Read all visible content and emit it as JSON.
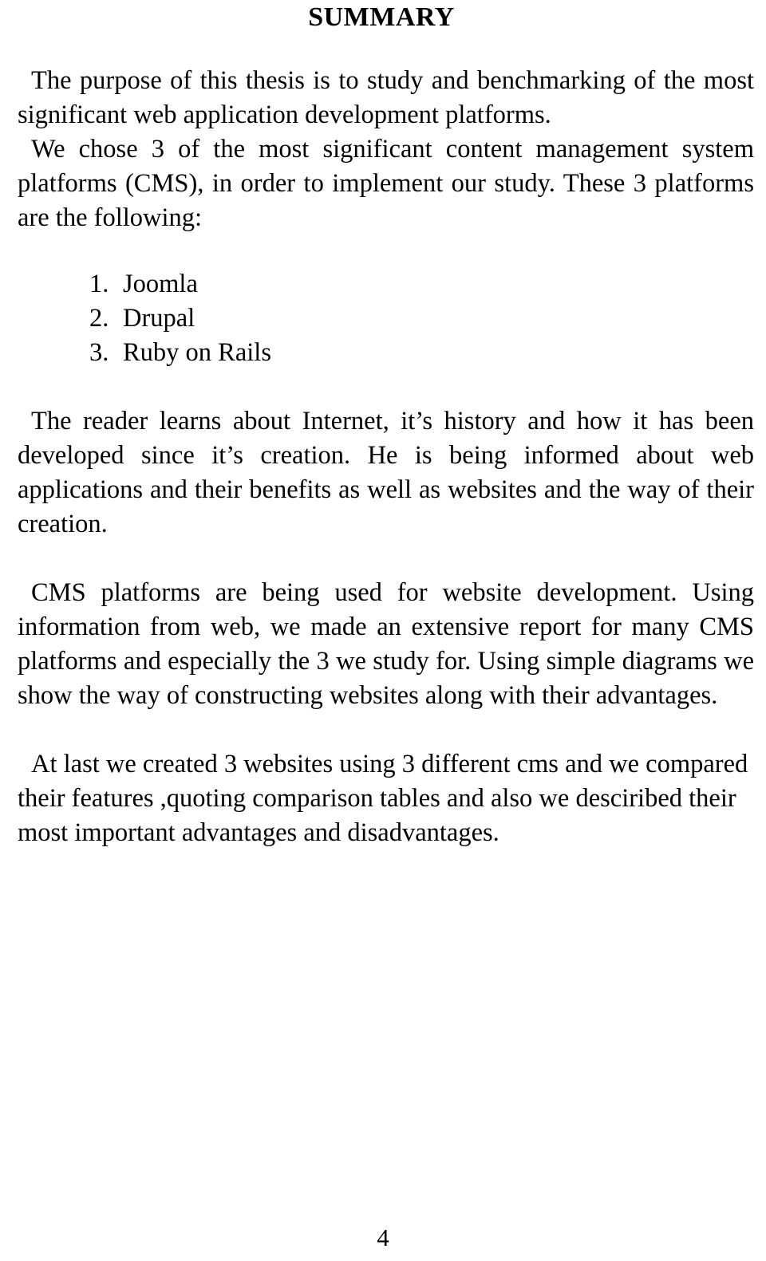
{
  "document": {
    "title": "SUMMARY",
    "page_number": "4",
    "paragraphs": [
      {
        "id": "purpose",
        "text": "The purpose of this thesis is to study and benchmarking of the most significant web application development platforms.",
        "align": "justify"
      },
      {
        "id": "chose-cms",
        "text": "We chose 3 of the most significant content management system platforms (CMS), in order to implement our study. These 3 platforms are the following:",
        "align": "justify"
      },
      {
        "id": "reader-learns",
        "text": "The reader learns about Internet, it’s history and how it has been developed since it’s creation. He is being informed about web applications and their benefits as well as websites and the way of their creation.",
        "align": "justify"
      },
      {
        "id": "cms-platforms-used",
        "text": "CMS platforms are being used for website development. Using information from web,  we made an extensive report for many CMS platforms and especially the 3 we study for. Using simple diagrams we show the way of constructing websites along with their advantages.",
        "align": "justify"
      },
      {
        "id": "at-last",
        "text": "At last we created 3 websites using 3 different cms and we compared their features ,quoting comparison tables and also we desciribed their most important advantages and disadvantages.",
        "align": "left"
      }
    ],
    "platform_list": [
      {
        "number": "1.",
        "label": "Joomla"
      },
      {
        "number": "2.",
        "label": "Drupal"
      },
      {
        "number": "3.",
        "label": "Ruby on Rails"
      }
    ]
  }
}
